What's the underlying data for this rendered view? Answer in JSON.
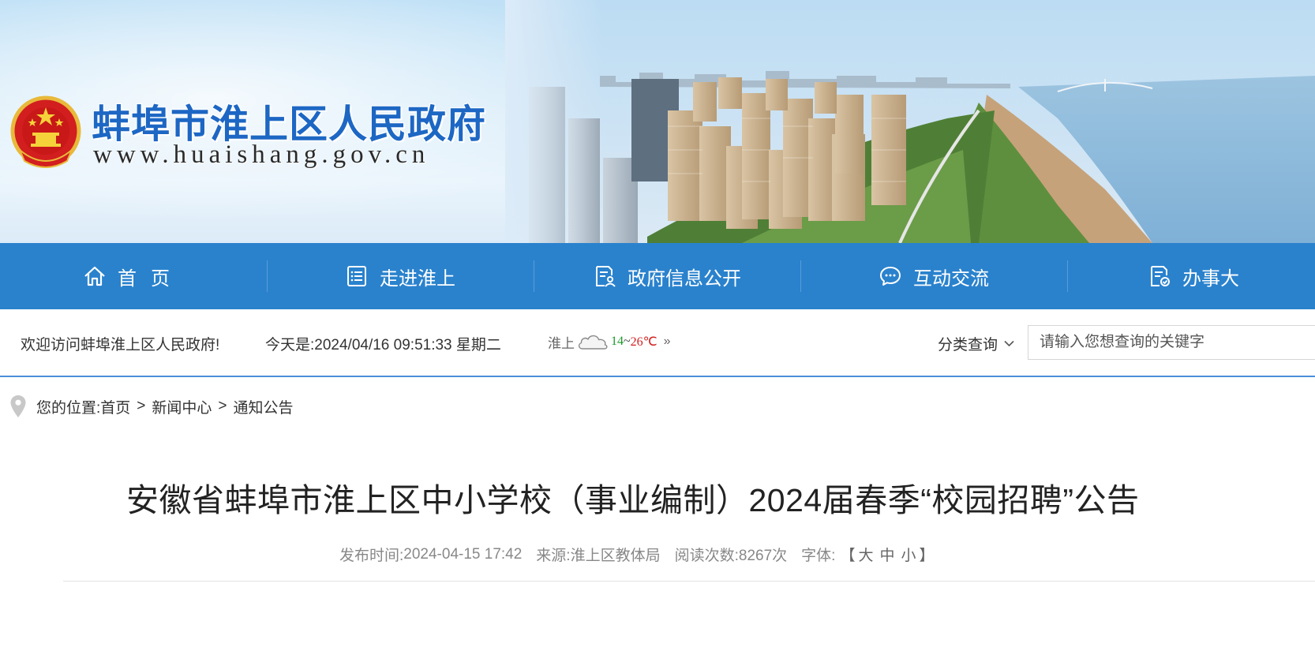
{
  "header": {
    "site_name": "蚌埠市淮上区人民政府",
    "site_url": "www.huaishang.gov.cn",
    "emblem_icon": "national-emblem-icon"
  },
  "nav": {
    "items": [
      {
        "label": "首页",
        "icon": "home-icon"
      },
      {
        "label": "走进淮上",
        "icon": "list-icon"
      },
      {
        "label": "政府信息公开",
        "icon": "document-person-icon"
      },
      {
        "label": "互动交流",
        "icon": "chat-bubble-icon"
      },
      {
        "label": "办事大",
        "icon": "document-check-icon"
      }
    ],
    "bg_color": "#2a82cd"
  },
  "infobar": {
    "welcome": "欢迎访问蚌埠淮上区人民政府!",
    "today_label": "今天是:",
    "datetime": "2024/04/16 09:51:33 星期二",
    "weather": {
      "city": "淮上",
      "icon": "cloud-icon",
      "low": "14",
      "sep": "~",
      "high": "26℃",
      "more_icon": "double-chevron-right-icon"
    },
    "category_select": "分类查询",
    "search_placeholder": "请输入您想查询的关键字"
  },
  "breadcrumb": {
    "prefix": "您的位置:",
    "items": [
      "首页",
      "新闻中心",
      "通知公告"
    ],
    "separator": ">"
  },
  "article": {
    "title": "安徽省蚌埠市淮上区中小学校（事业编制）2024届春季“校园招聘”公告",
    "publish_label": "发布时间:",
    "publish_time": "2024-04-15 17:42",
    "source_label": "来源:",
    "source": "淮上区教体局",
    "views_label": "阅读次数:",
    "views": "8267次",
    "font_label": "字体:",
    "font_sizes": [
      "大",
      "中",
      "小"
    ]
  },
  "colors": {
    "accent": "#2a82cd",
    "site_name": "#1d67c4",
    "temp_low": "#1a9a2a",
    "temp_high": "#d32020"
  }
}
